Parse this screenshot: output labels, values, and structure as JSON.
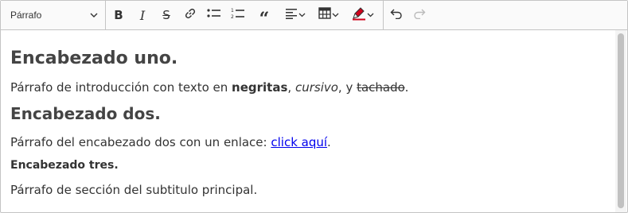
{
  "toolbar": {
    "heading_select": {
      "value": "Párrafo"
    },
    "tools": [
      {
        "name": "bold",
        "icon": "bold-icon",
        "glyph": "B"
      },
      {
        "name": "italic",
        "icon": "italic-icon",
        "glyph": "I"
      },
      {
        "name": "strikethrough",
        "icon": "strikethrough-icon",
        "glyph": "S"
      },
      {
        "name": "link",
        "icon": "link-icon"
      },
      {
        "name": "bulleted-list",
        "icon": "bulleted-list-icon"
      },
      {
        "name": "numbered-list",
        "icon": "numbered-list-icon"
      },
      {
        "name": "block-quote",
        "icon": "quote-icon",
        "glyph": "“"
      },
      {
        "name": "alignment",
        "icon": "align-left-icon"
      },
      {
        "name": "insert-table",
        "icon": "table-icon"
      },
      {
        "name": "highlight",
        "icon": "highlighter-icon"
      },
      {
        "name": "undo",
        "icon": "undo-icon"
      },
      {
        "name": "redo",
        "icon": "redo-icon"
      }
    ],
    "colors": {
      "icon": "#333333",
      "disabled": "#bbbbbb",
      "highlight": "#d0021b"
    }
  },
  "content": {
    "heading1": "Encabezado uno.",
    "para1": {
      "intro": "Párrafo de introducción con texto en ",
      "bold": "negritas",
      "sep1": ", ",
      "italic": "cursivo",
      "sep2": ", y ",
      "strike": "tachado",
      "end": "."
    },
    "heading2": "Encabezado dos.",
    "para2": {
      "intro": "Párrafo del encabezado dos con un enlace: ",
      "link": "click aquí",
      "end": "."
    },
    "heading3": "Encabezado tres.",
    "para3": "Párrafo de sección del subtitulo principal.",
    "link_color": "#0000ee"
  }
}
